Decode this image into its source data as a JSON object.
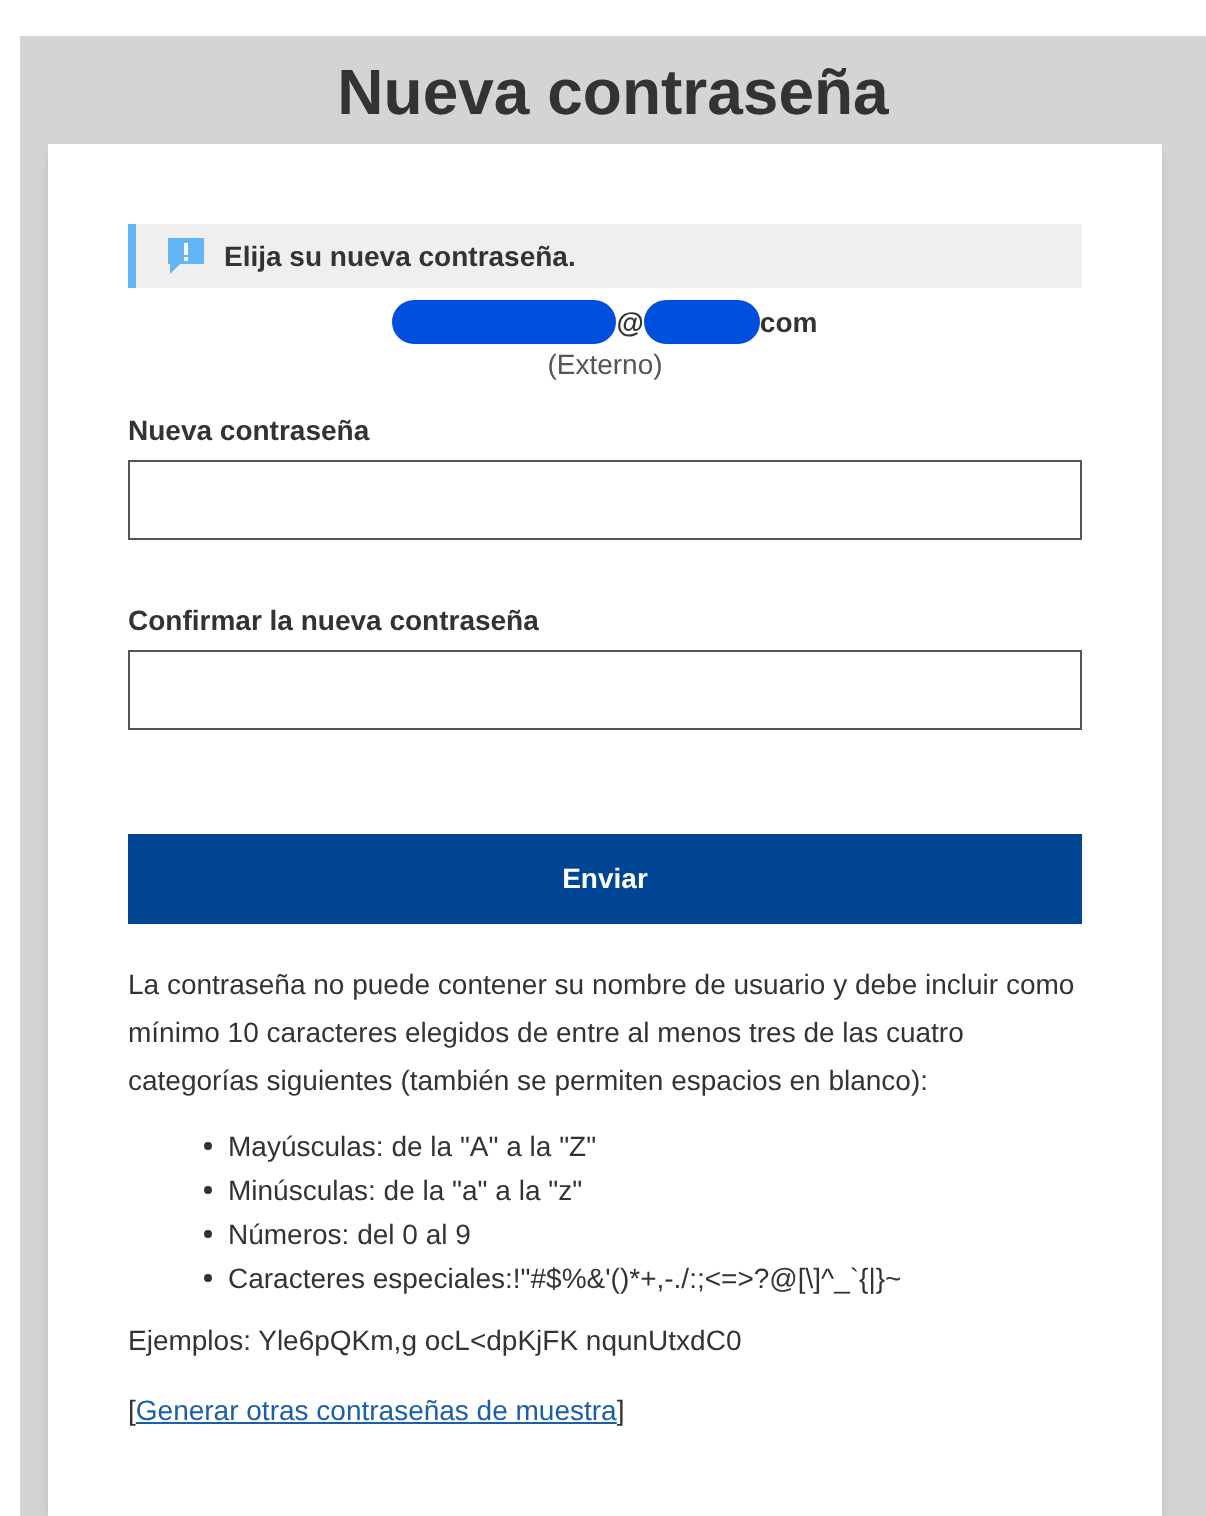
{
  "title": "Nueva contraseña",
  "notice": {
    "text": "Elija su nueva contraseña."
  },
  "account": {
    "at": "@",
    "domain_end": "com",
    "type": "(Externo)"
  },
  "fields": [
    {
      "label": "Nueva contraseña"
    },
    {
      "label": "Confirmar la nueva contraseña"
    }
  ],
  "submit": "Enviar",
  "rules": {
    "intro": "La contraseña no puede contener su nombre de usuario y debe incluir como mínimo 10 caracteres elegidos de entre al menos tres de las cuatro categorías siguientes (también se permiten espacios en blanco):",
    "items": [
      "Mayúsculas: de la \"A\" a la \"Z\"",
      "Minúsculas: de la \"a\" a la \"z\"",
      "Números: del 0 al 9",
      "Caracteres especiales:!\"#$%&'()*+,-./:;<=>?@[\\]^_`{|}~"
    ]
  },
  "examples": "Ejemplos: Yle6pQKm,g ocL<dpKjFK nqunUtxdC0",
  "generate": {
    "open": "[",
    "link": "Generar otras contraseñas de muestra",
    "close": "]"
  }
}
